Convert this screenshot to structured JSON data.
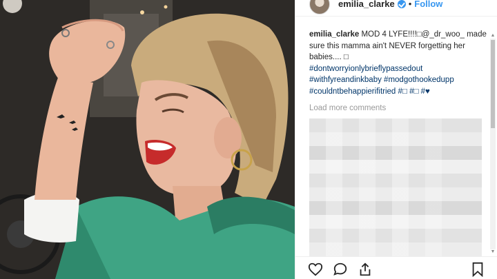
{
  "post": {
    "username": "emilia_clarke",
    "dot": "•",
    "follow_label": "Follow"
  },
  "caption": {
    "username": "emilia_clarke",
    "text_1": " MOD 4 LYFE!!!!□@_dr_woo_ made sure this mamma ain't NEVER forgetting her babies.... □",
    "hashtags": [
      "#dontworryionlybrieflypassedout",
      "#withfyreandinkbaby",
      "#modgothookedupp",
      "#couldntbehappierifitried",
      "#□",
      "#□",
      "#♥"
    ]
  },
  "comments": {
    "load_more": "Load more comments"
  },
  "icons": {
    "like": "heart-icon",
    "comment": "comment-icon",
    "share": "share-icon",
    "save": "bookmark-icon",
    "verified": "verified-badge-icon"
  },
  "colors": {
    "accent": "#3897f0",
    "hashtag": "#003569",
    "muted": "#999999"
  }
}
